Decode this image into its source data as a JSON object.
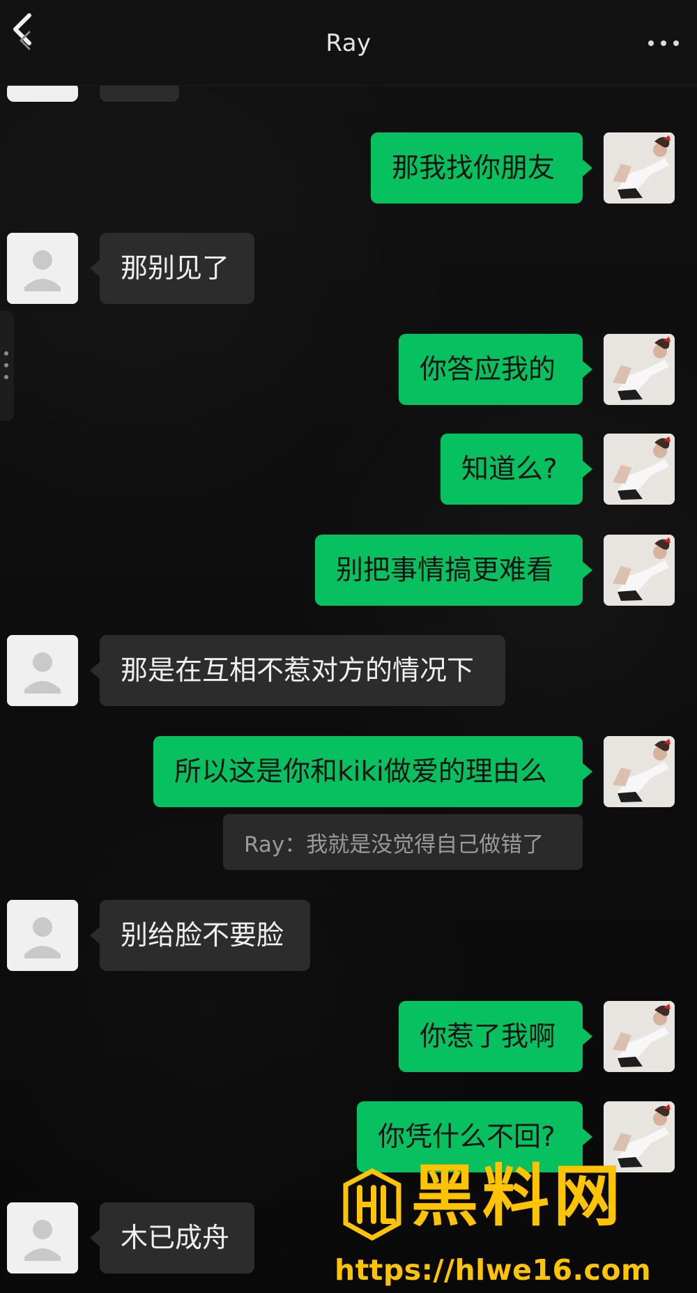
{
  "header": {
    "title": "Ray"
  },
  "messages": [
    {
      "side": "right",
      "text": "那我找你朋友"
    },
    {
      "side": "left",
      "text": "那别见了"
    },
    {
      "side": "right",
      "text": "你答应我的"
    },
    {
      "side": "right",
      "text": "知道么?"
    },
    {
      "side": "right",
      "text": "别把事情搞更难看"
    },
    {
      "side": "left",
      "text": "那是在互相不惹对方的情况下"
    },
    {
      "side": "right",
      "text": "所以这是你和kiki做爱的理由么"
    },
    {
      "side": "left",
      "text": "别给脸不要脸"
    },
    {
      "side": "right",
      "text": "你惹了我啊"
    },
    {
      "side": "right",
      "text": "你凭什么不回?"
    },
    {
      "side": "left",
      "text": "木已成舟"
    }
  ],
  "quoted_reply": {
    "text": "Ray：我就是没觉得自己做错了"
  },
  "watermark": {
    "title": "黑料网",
    "url": "https://hlwe16.com"
  },
  "colors": {
    "accent_green": "#07c160",
    "incoming_bubble": "#2c2c2c",
    "watermark_gold": "#ffc400"
  },
  "icons": {
    "back": "chevron-left-icon",
    "more": "more-icon",
    "default_avatar": "default-avatar-icon",
    "user_avatar": "user-photo-avatar"
  }
}
